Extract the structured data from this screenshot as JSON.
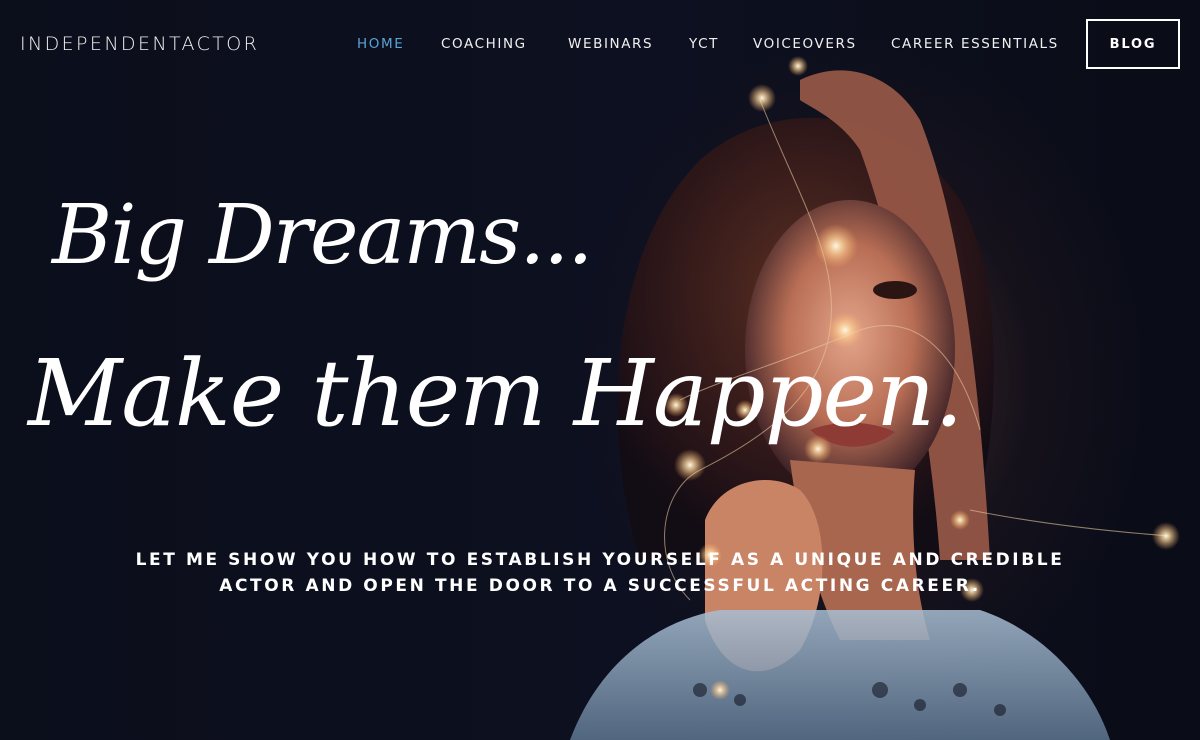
{
  "brand": {
    "logo_text": "INDEPENDENTACTOR"
  },
  "nav": {
    "items": [
      {
        "label": "HOME",
        "active": true
      },
      {
        "label": "COACHING"
      },
      {
        "label": "WEBINARS"
      },
      {
        "label": "YCT"
      },
      {
        "label": "VOICEOVERS"
      },
      {
        "label": "CAREER ESSENTIALS"
      }
    ],
    "blog_label": "BLOG",
    "active_color": "#5aa3d6"
  },
  "hero": {
    "headline_line1": "Big Dreams...",
    "headline_line2": "Make them Happen.",
    "tagline_line1": "LET ME SHOW YOU HOW TO ESTABLISH YOURSELF AS A UNIQUE AND CREDIBLE",
    "tagline_line2": "ACTOR AND OPEN THE DOOR TO A SUCCESSFUL ACTING CAREER.",
    "background_color": "#0c0f1c"
  }
}
